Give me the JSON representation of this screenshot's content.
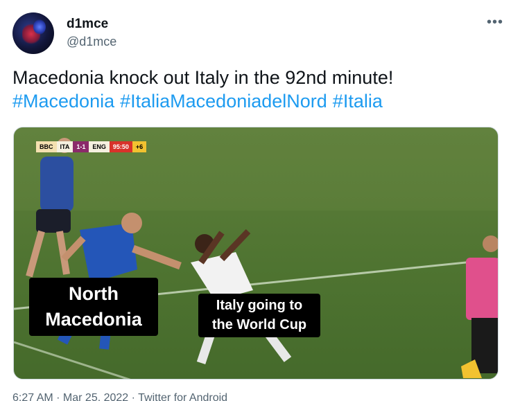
{
  "author": {
    "display_name": "d1mce",
    "handle": "@d1mce",
    "more_icon": "more-horizontal-icon"
  },
  "tweet": {
    "text": "Macedonia knock out Italy in the 92nd minute!",
    "hashtags": [
      "#Macedonia",
      "#ItaliaMacedoniadelNord",
      "#Italia"
    ]
  },
  "media": {
    "scorebug": {
      "logo": "BBC",
      "team1": "ITA",
      "score": "1-1",
      "team2": "ENG",
      "time": "95:50",
      "added": "+6"
    },
    "caption_left": [
      "North",
      "Macedonia"
    ],
    "caption_right": [
      "Italy going to",
      "the World Cup"
    ]
  },
  "footer": {
    "meta": "6:27 AM · Mar 25, 2022 · Twitter for Android"
  }
}
